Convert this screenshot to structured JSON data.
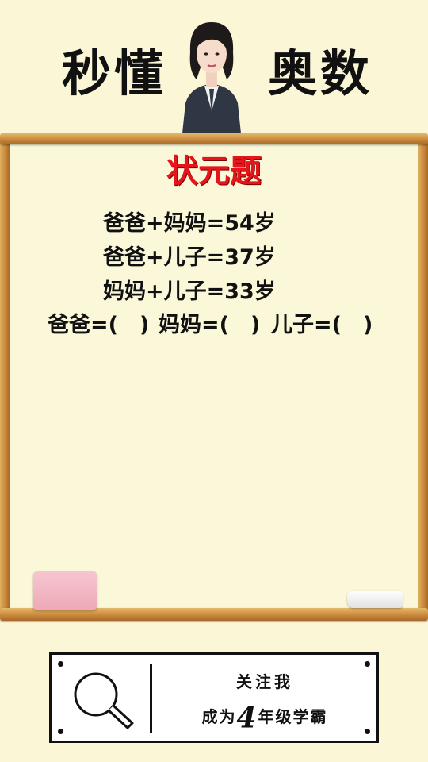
{
  "header": {
    "left": "秒懂",
    "right": "奥数"
  },
  "puzzle": {
    "title": "状元题",
    "equations": [
      "爸爸+妈妈=54岁",
      "爸爸+儿子=37岁",
      "妈妈+儿子=33岁"
    ],
    "question": [
      "爸爸=(　)",
      "妈妈=(　)",
      "儿子=(　)"
    ]
  },
  "banner": {
    "follow": "关注我",
    "tagline_before": "成为",
    "grade": "4",
    "tagline_after": "年级学霸"
  },
  "icons": {
    "search": "magnifier-icon",
    "presenter": "presenter-icon"
  },
  "colors": {
    "title": "#e4161b",
    "background": "#fbf6d6",
    "frame": "#c98a3c",
    "eraser": "#f2b8c5"
  }
}
